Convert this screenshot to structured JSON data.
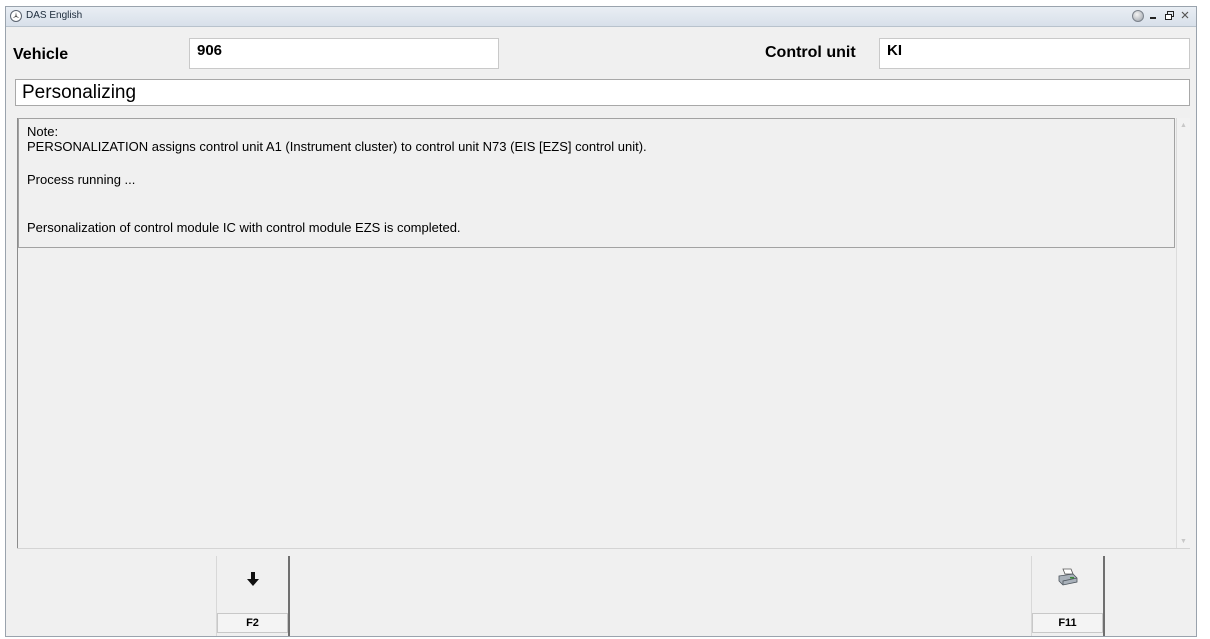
{
  "window": {
    "title": "DAS English"
  },
  "vehicle": {
    "label": "Vehicle",
    "value": "906"
  },
  "control_unit": {
    "label": "Control unit",
    "value": "KI"
  },
  "header": {
    "title": "Personalizing"
  },
  "note": {
    "heading": "Note:",
    "line1": "PERSONALIZATION assigns control unit A1 (Instrument cluster) to control unit N73 (EIS [EZS] control unit).",
    "line2": "Process running ...",
    "line3": "Personalization of control module IC with control module EZS is completed."
  },
  "function_keys": [
    {
      "label": "F2",
      "icon": "down-arrow-icon"
    },
    {
      "label": "F11",
      "icon": "printer-icon"
    }
  ]
}
